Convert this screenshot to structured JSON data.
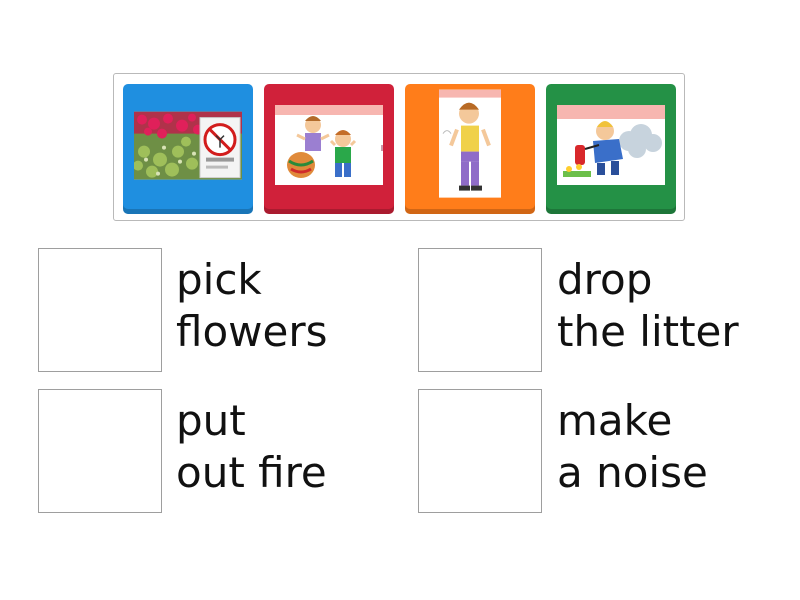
{
  "tiles": [
    {
      "name": "tile-flower-sign",
      "color": "#1f8fe0",
      "icon": "no-picking-flowers-sign-image"
    },
    {
      "name": "tile-boys-pot",
      "color": "#d0213a",
      "icon": "boys-with-pot-image"
    },
    {
      "name": "tile-boy-standing",
      "color": "#ff7d1a",
      "icon": "boy-standing-image"
    },
    {
      "name": "tile-boy-extinguisher",
      "color": "#249146",
      "icon": "boy-putting-out-fire-image"
    }
  ],
  "answers": [
    {
      "line1": "pick",
      "line2": "flowers"
    },
    {
      "line1": "drop",
      "line2": "the litter"
    },
    {
      "line1": "put",
      "line2": "out fire"
    },
    {
      "line1": "make",
      "line2": "a noise"
    }
  ]
}
